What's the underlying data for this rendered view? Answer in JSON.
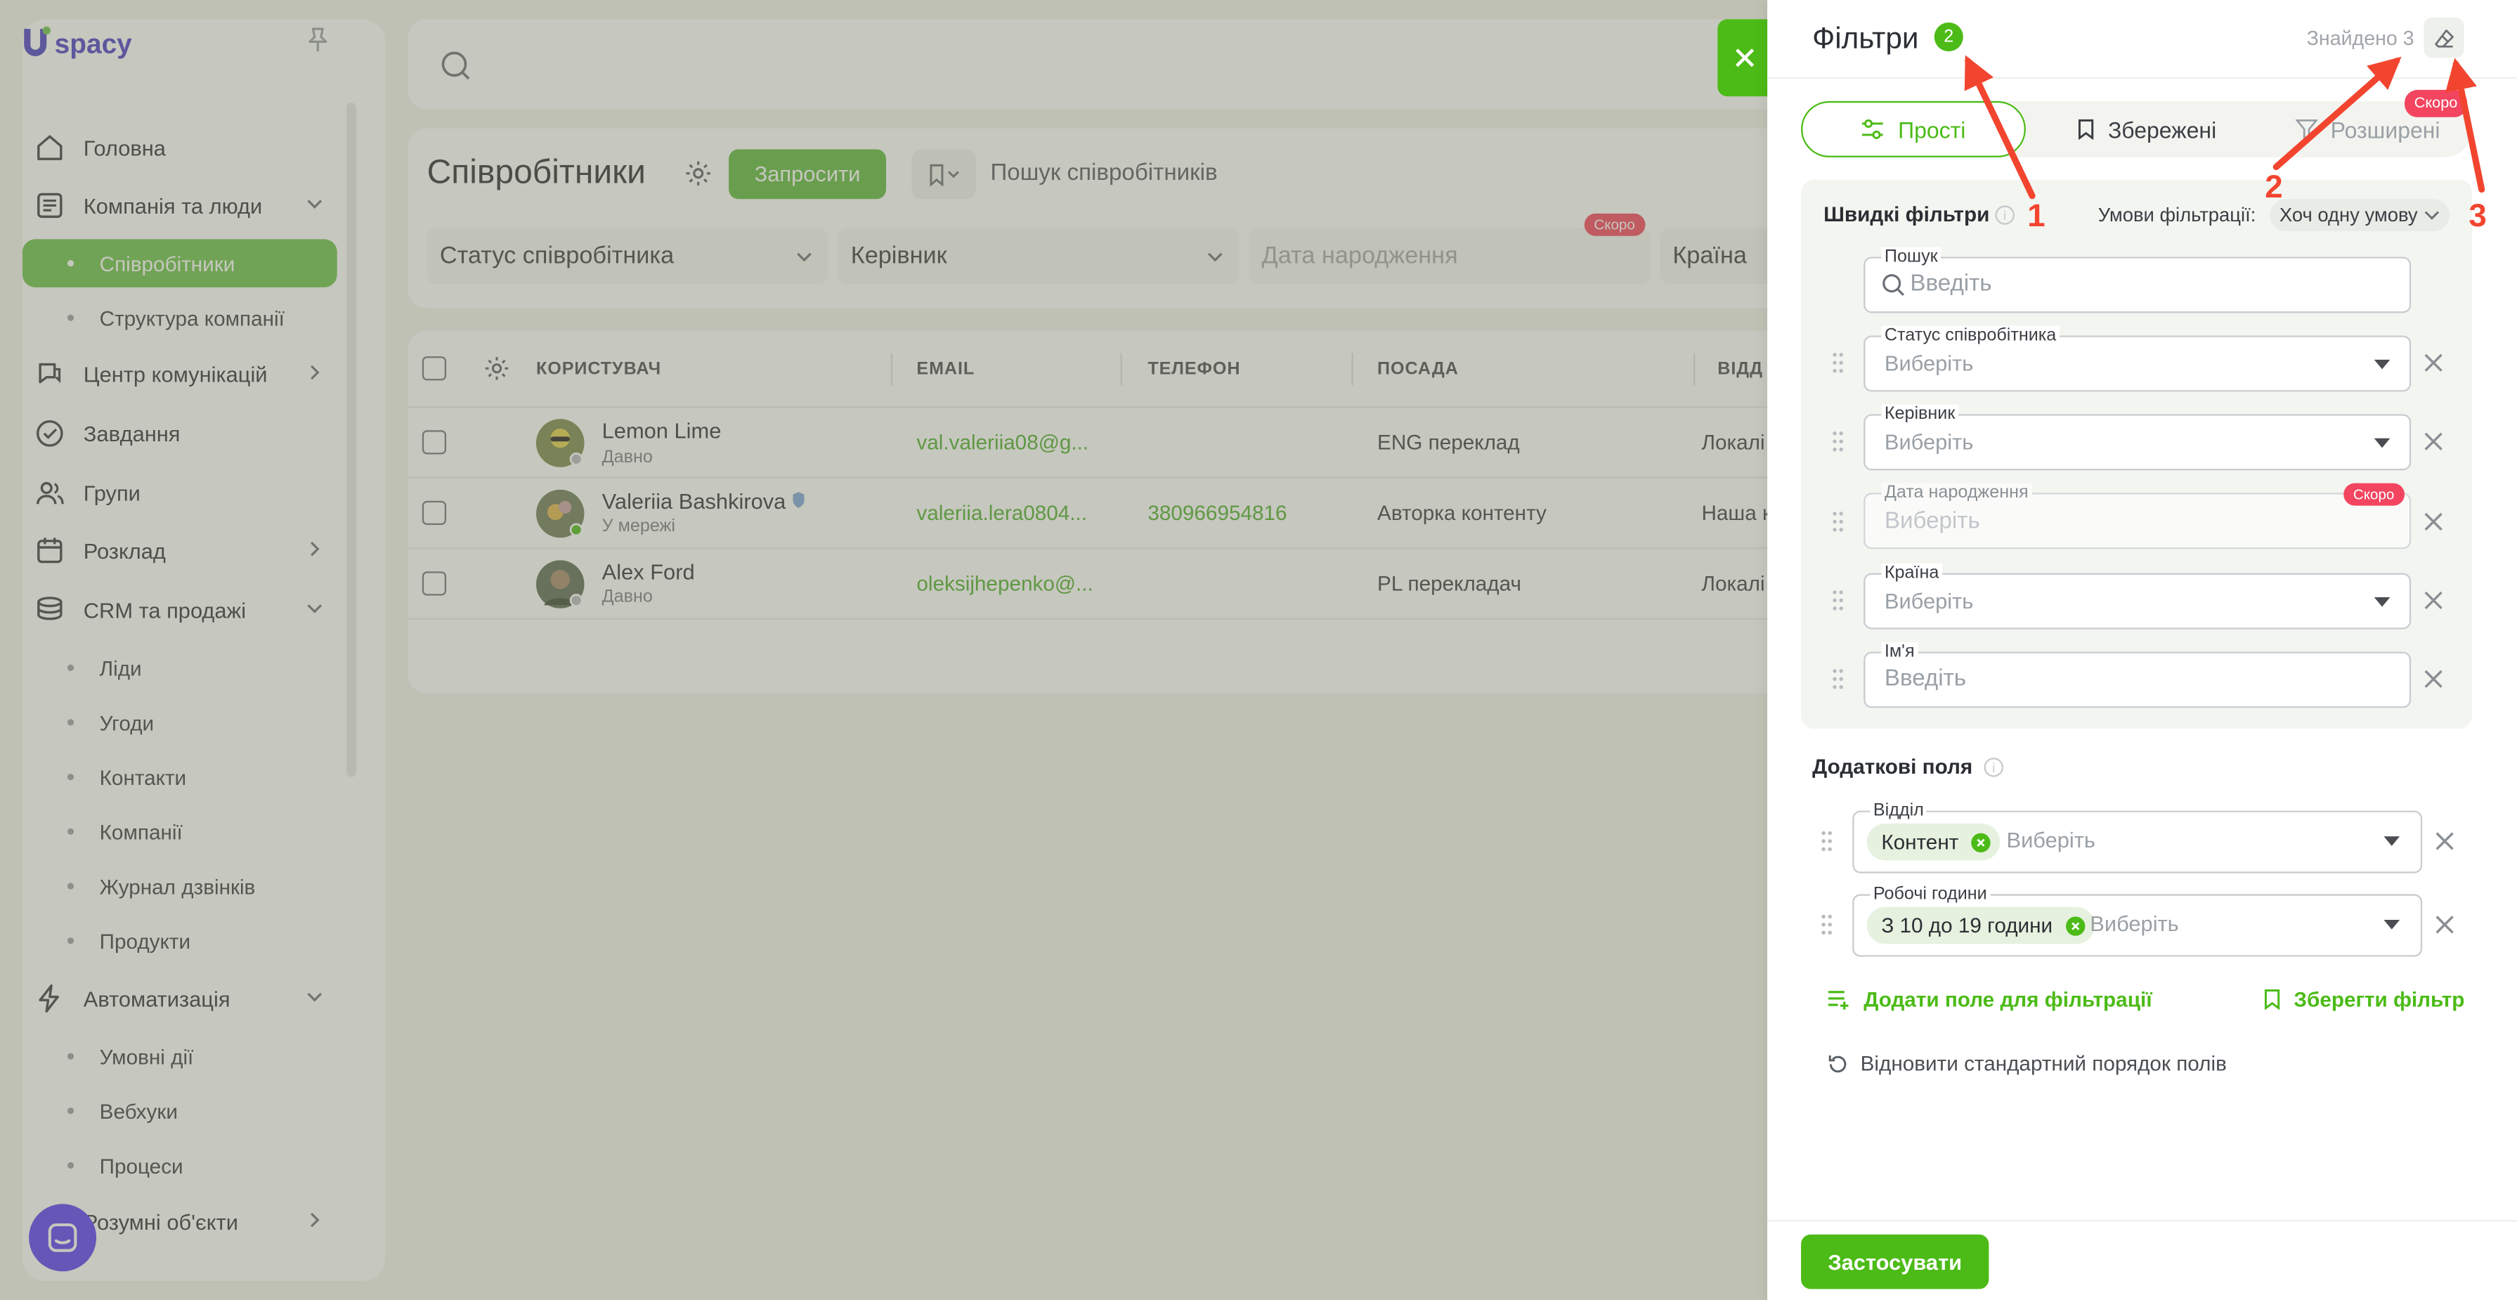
{
  "sidebar": {
    "logo": "spacy",
    "items": [
      {
        "label": "Головна",
        "icon": "home-icon"
      },
      {
        "label": "Компанія та люди",
        "icon": "company-icon"
      },
      {
        "label": "Центр комунікацій",
        "icon": "chat-icon"
      },
      {
        "label": "Завдання",
        "icon": "check-circle-icon"
      },
      {
        "label": "Групи",
        "icon": "users-icon"
      },
      {
        "label": "Розклад",
        "icon": "calendar-icon"
      },
      {
        "label": "CRM та продажі",
        "icon": "coins-icon"
      },
      {
        "label": "Автоматизація",
        "icon": "lightning-icon"
      },
      {
        "label": "Розумні об'єкти",
        "icon": "chevron-right-icon"
      }
    ],
    "company_sub": [
      "Співробітники",
      "Структура компанії"
    ],
    "crm_sub": [
      "Ліди",
      "Угоди",
      "Контакти",
      "Компанії",
      "Журнал дзвінків",
      "Продукти"
    ],
    "auto_sub": [
      "Умовні дії",
      "Вебхуки",
      "Процеси"
    ]
  },
  "main": {
    "title": "Співробітники",
    "invite_label": "Запросити",
    "search_placeholder": "Пошук співробітників",
    "filters": {
      "status": "Статус співробітника",
      "manager": "Керівник",
      "birth": "Дата народження",
      "country": "Країна",
      "soon": "Скоро"
    },
    "table": {
      "headers": [
        "КОРИСТУВАЧ",
        "EMAIL",
        "ТЕЛЕФОН",
        "ПОСАДА",
        "ВІДД"
      ],
      "rows": [
        {
          "name": "Lemon Lime",
          "status": "Давно",
          "email": "val.valeriia08@g...",
          "phone": "",
          "position": "ENG переклад",
          "dept": "Локалі"
        },
        {
          "name": "Valeriia Bashkirova",
          "status": "У мережі",
          "email": "valeriia.lera0804...",
          "phone": "380966954816",
          "position": "Авторка контенту",
          "dept": "Наша к"
        },
        {
          "name": "Alex Ford",
          "status": "Давно",
          "email": "oleksijhepenko@...",
          "phone": "",
          "position": "PL перекладач",
          "dept": "Локалі"
        }
      ]
    }
  },
  "panel": {
    "title": "Фільтри",
    "count": "2",
    "found": "Знайдено 3",
    "tabs": [
      "Прості",
      "Збережені",
      "Розширені"
    ],
    "soon": "Скоро",
    "quick": {
      "title": "Швидкі фільтри",
      "cond_label": "Умови фільтрації:",
      "cond_value": "Хоч одну умову",
      "search_label": "Пошук",
      "search_placeholder": "Введіть",
      "status_label": "Статус співробітника",
      "manager_label": "Керівник",
      "birth_label": "Дата народження",
      "country_label": "Країна",
      "name_label": "Ім'я",
      "select_placeholder": "Виберіть",
      "input_placeholder": "Введіть"
    },
    "additional": {
      "title": "Додаткові поля",
      "dept_label": "Відділ",
      "dept_chip": "Контент",
      "hours_label": "Робочі години",
      "hours_chip": "З 10 до 19 години",
      "select_placeholder": "Виберіть"
    },
    "add_field": "Додати поле для фільтрації",
    "save_filter": "Зберегти фільтр",
    "restore": "Відновити стандартний порядок полів",
    "apply": "Застосувати"
  },
  "annotations": [
    "1",
    "2",
    "3"
  ],
  "colors": {
    "accent": "#4cbb17",
    "badge": "#f3455f",
    "arrow": "#f2452f"
  }
}
